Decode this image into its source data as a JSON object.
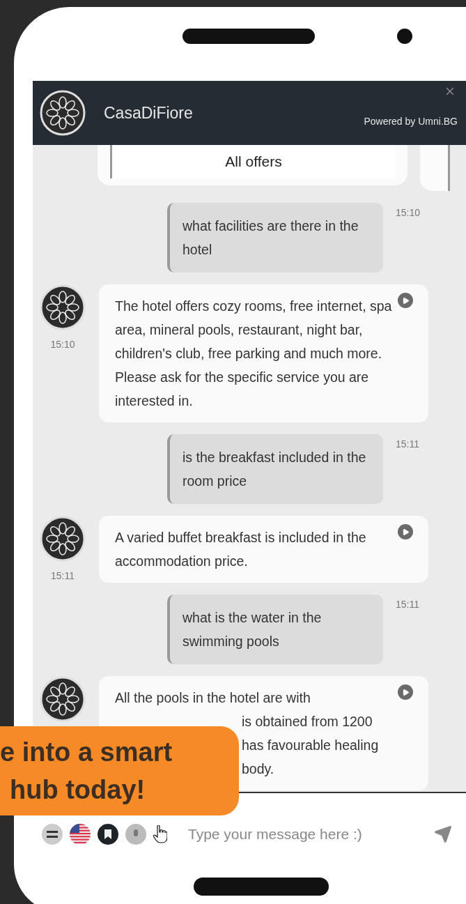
{
  "header": {
    "title": "CasaDiFiore",
    "powered_by": "Powered by Umni.BG"
  },
  "carousel": {
    "button": "All offers"
  },
  "messages": [
    {
      "kind": "user",
      "text": "what facilities are there in the hotel",
      "time": "15:10"
    },
    {
      "kind": "bot",
      "text": "The hotel offers cozy rooms, free internet, spa area, mineral pools, restaurant, night bar, children's club, free parking and much more. Please ask for the specific service you are interested in.",
      "time": "15:10"
    },
    {
      "kind": "user",
      "text": "is the breakfast included in the room price",
      "time": "15:11"
    },
    {
      "kind": "bot",
      "text": "A varied buffet breakfast is included in the accommodation price.",
      "time": "15:11"
    },
    {
      "kind": "user",
      "text": "what is the water in the swimming pools",
      "time": "15:11"
    },
    {
      "kind": "bot",
      "lines": [
        {
          "kind": "full",
          "text": "All the pools in the hotel are with"
        },
        {
          "kind": "tail",
          "text": "is obtained from 1200"
        },
        {
          "kind": "tail",
          "text": "has favourable healing"
        },
        {
          "kind": "tail",
          "text": "body."
        }
      ]
    }
  ],
  "composer": {
    "placeholder": "Type your message here :)"
  },
  "banner": {
    "lines": [
      "e into a smart",
      "hub today!"
    ]
  }
}
